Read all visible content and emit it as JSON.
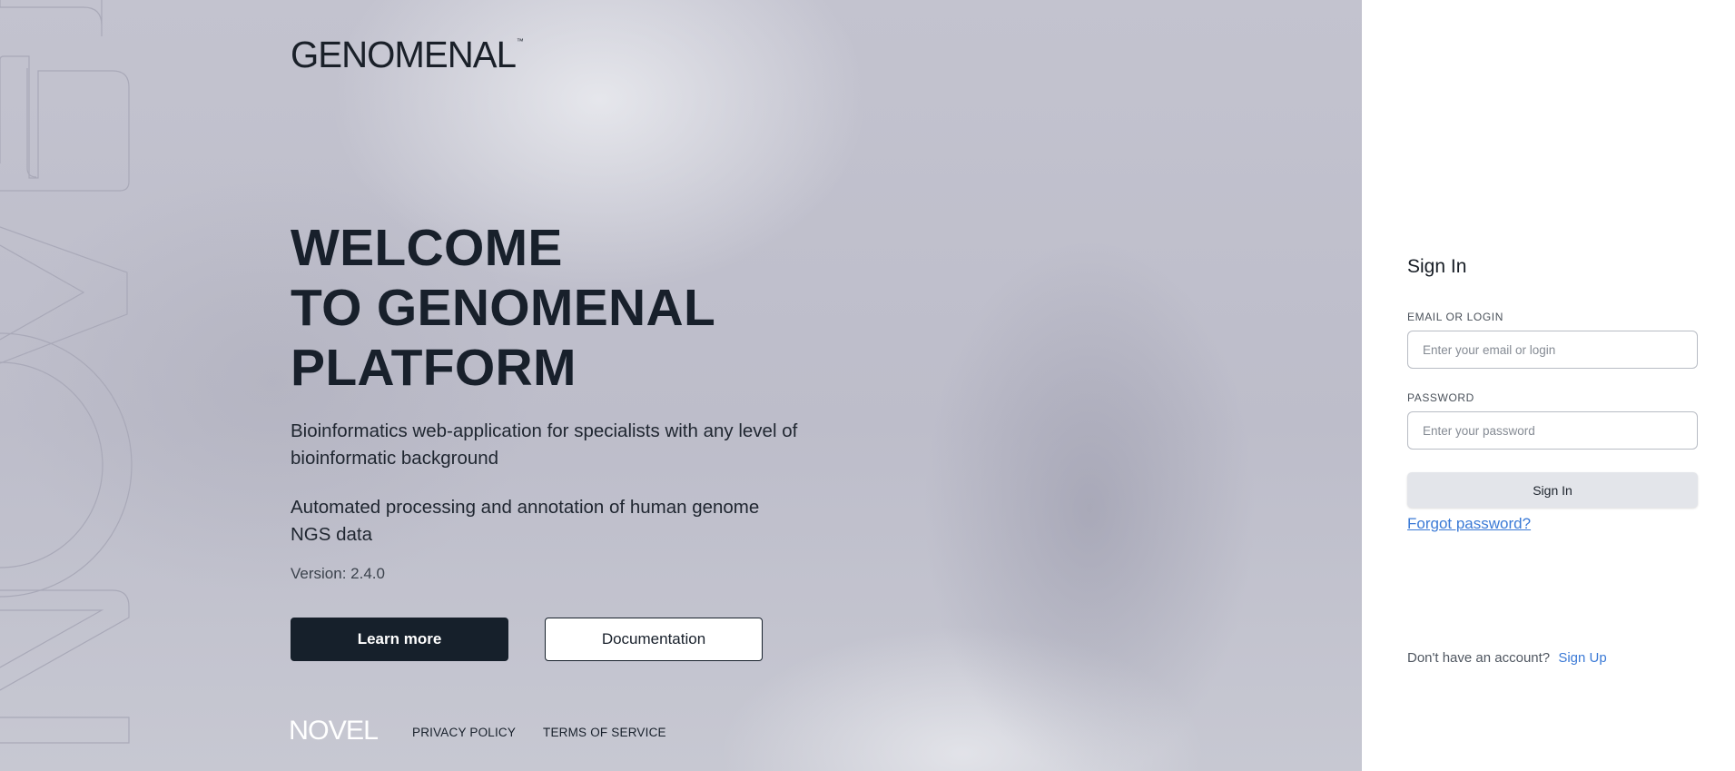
{
  "hero": {
    "logo": "GENOMENAL",
    "logo_tm": "™",
    "headline": [
      "WELCOME",
      "TO GENOMENAL",
      "PLATFORM"
    ],
    "description_1": "Bioinformatics web-application for specialists with any level of bioinformatic background",
    "description_2": "Automated processing and annotation of human genome NGS data",
    "version": "Version: 2.4.0",
    "learn_more_label": "Learn more",
    "documentation_label": "Documentation",
    "footer_logo": "NOVEL",
    "privacy_label": "PRIVACY POLICY",
    "terms_label": "TERMS OF SERVICE"
  },
  "signin": {
    "title": "Sign In",
    "email_label": "EMAIL OR LOGIN",
    "email_placeholder": "Enter your email or login",
    "email_value": "",
    "password_label": "PASSWORD",
    "password_placeholder": "Enter your password",
    "password_value": "",
    "submit_label": "Sign In",
    "forgot_label": "Forgot password?",
    "no_account_text": "Don't have an account?",
    "signup_label": "Sign Up"
  },
  "colors": {
    "dark": "#16202b",
    "link": "#3b7ad6",
    "panel_bg": "#ffffff",
    "button_bg": "#e3e5ea"
  }
}
